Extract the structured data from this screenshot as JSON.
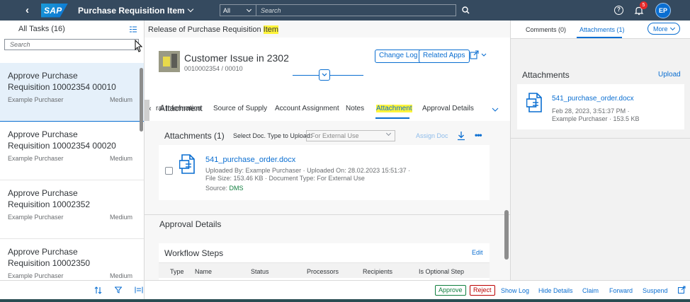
{
  "shell": {
    "logo": "SAP",
    "app_title": "Purchase Requisition Item",
    "scope": "All",
    "search_placeholder": "Search",
    "notification_count": "5",
    "avatar_initials": "EP"
  },
  "master": {
    "header": "All Tasks (16)",
    "search_placeholder": "Search",
    "tasks": [
      {
        "title": "Approve Purchase Requisition 10002354 00010",
        "purchaser": "Example Purchaser",
        "priority": "Medium"
      },
      {
        "title": "Approve Purchase Requisition 10002354 00020",
        "purchaser": "Example Purchaser",
        "priority": "Medium"
      },
      {
        "title": "Approve Purchase Requisition 10002352",
        "purchaser": "Example Purchaser",
        "priority": "Medium"
      },
      {
        "title": "Approve Purchase Requisition 10002350",
        "purchaser": "Example Purchaser",
        "priority": "Medium"
      }
    ]
  },
  "detail": {
    "page_title_prefix": "Release of Purchase Requisition ",
    "page_title_highlight": "Item",
    "object_title": "Customer Issue in 2302",
    "object_subtitle": "0010002354 / 00010",
    "change_log": "Change Log",
    "related_apps": "Related Apps",
    "tabs": [
      "ral Information",
      "Source of Supply",
      "Account Assignment",
      "Notes",
      "Attachment",
      "Approval Details"
    ],
    "attachment_section": "Attachment",
    "attachments_label": "Attachments (1)",
    "select_doc_label": "Select Doc. Type to Upload:",
    "doc_type_value": "For External Use",
    "assign_doc": "Assign Doc",
    "file_name": "541_purchase_order.docx",
    "file_meta_line1": "Uploaded By: Example Purchaser · Uploaded On: 28.02.2023 15:51:37 ·",
    "file_meta_line2": "File Size: 153.46 KB · Document Type: For External Use",
    "source_label": "Source: ",
    "source_value": "DMS",
    "approval_section": "Approval Details",
    "workflow_title": "Workflow Steps",
    "workflow_edit": "Edit",
    "workflow_columns": [
      "Type",
      "Name",
      "Status",
      "Processors",
      "Recipients",
      "Is Optional Step"
    ]
  },
  "side": {
    "tab_comments": "Comments (0)",
    "tab_attachments": "Attachments (1)",
    "more": "More",
    "heading": "Attachments",
    "upload": "Upload",
    "file_name": "541_purchase_order.docx",
    "file_date": "Feb 28, 2023, 3:51:37 PM ·",
    "file_by": "Example Purchaser · 153.5 KB"
  },
  "footer": {
    "approve": "Approve",
    "reject": "Reject",
    "show_log": "Show Log",
    "hide_details": "Hide Details",
    "claim": "Claim",
    "forward": "Forward",
    "suspend": "Suspend"
  },
  "colors": {
    "shell": "#354a5f",
    "accent": "#0a6ed1",
    "approve": "#107e3e",
    "reject": "#bb0000",
    "highlight": "#fff43a"
  }
}
